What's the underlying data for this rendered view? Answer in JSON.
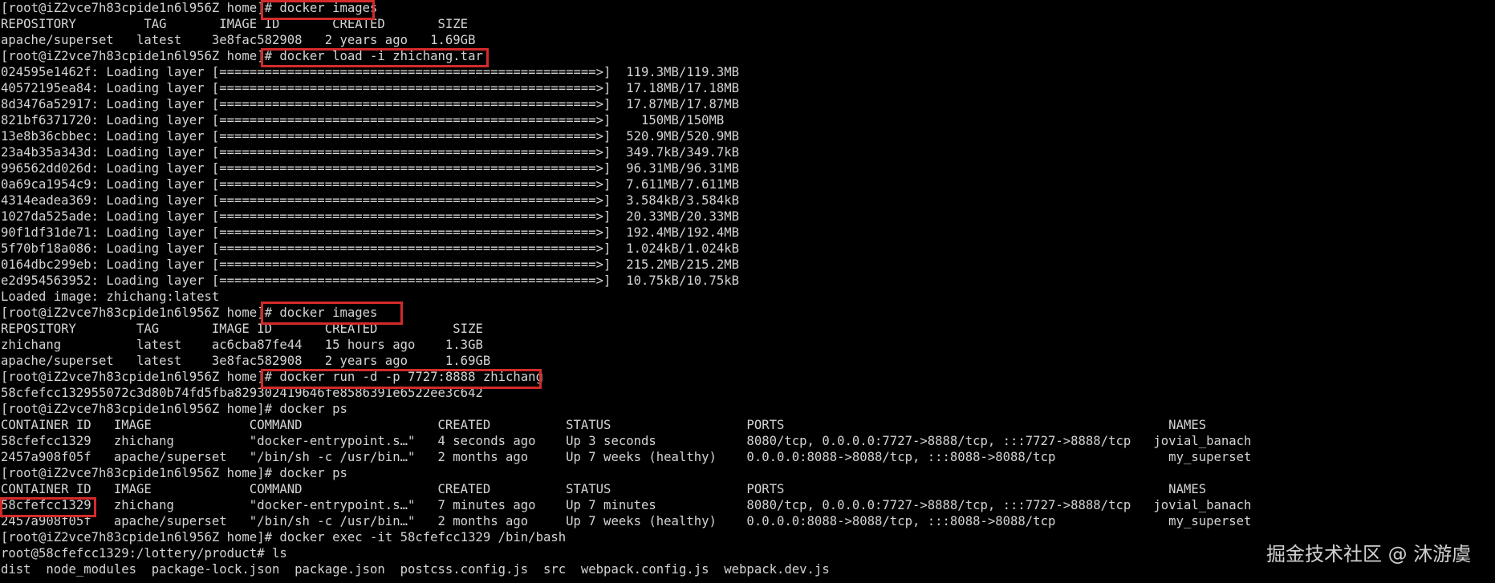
{
  "terminal": {
    "lines": [
      "[root@iZ2vce7h83cpide1n6l956Z home]# docker images",
      "REPOSITORY         TAG       IMAGE ID       CREATED       SIZE",
      "apache/superset   latest    3e8fac582908   2 years ago   1.69GB",
      "[root@iZ2vce7h83cpide1n6l956Z home]# docker load -i zhichang.tar",
      "024595e1462f: Loading layer [==================================================>]  119.3MB/119.3MB",
      "40572195ea84: Loading layer [==================================================>]  17.18MB/17.18MB",
      "8d3476a52917: Loading layer [==================================================>]  17.87MB/17.87MB",
      "821bf6371720: Loading layer [==================================================>]    150MB/150MB",
      "13e8b36cbbec: Loading layer [==================================================>]  520.9MB/520.9MB",
      "23a4b35a343d: Loading layer [==================================================>]  349.7kB/349.7kB",
      "996562dd026d: Loading layer [==================================================>]  96.31MB/96.31MB",
      "0a69ca1954c9: Loading layer [==================================================>]  7.611MB/7.611MB",
      "4314eadea369: Loading layer [==================================================>]  3.584kB/3.584kB",
      "1027da525ade: Loading layer [==================================================>]  20.33MB/20.33MB",
      "90f1df31de71: Loading layer [==================================================>]  192.4MB/192.4MB",
      "5f70bf18a086: Loading layer [==================================================>]  1.024kB/1.024kB",
      "0164dbc299eb: Loading layer [==================================================>]  215.2MB/215.2MB",
      "e2d954563952: Loading layer [==================================================>]  10.75kB/10.75kB",
      "Loaded image: zhichang:latest",
      "[root@iZ2vce7h83cpide1n6l956Z home]# docker images",
      "REPOSITORY        TAG       IMAGE ID       CREATED          SIZE",
      "zhichang          latest    ac6cba87fe44   15 hours ago    1.3GB",
      "apache/superset   latest    3e8fac582908   2 years ago     1.69GB",
      "[root@iZ2vce7h83cpide1n6l956Z home]# docker run -d -p 7727:8888 zhichang",
      "58cfefcc132955072c3d80b74fd5fba829302419646fe8586391e6522ee3c642",
      "[root@iZ2vce7h83cpide1n6l956Z home]# docker ps",
      "CONTAINER ID   IMAGE             COMMAND                  CREATED          STATUS                  PORTS                                                   NAMES",
      "58cfefcc1329   zhichang          \"docker-entrypoint.s…\"   4 seconds ago    Up 3 seconds            8080/tcp, 0.0.0.0:7727->8888/tcp, :::7727->8888/tcp   jovial_banach",
      "2457a908f05f   apache/superset   \"/bin/sh -c /usr/bin…\"   2 months ago     Up 7 weeks (healthy)    0.0.0.0:8088->8088/tcp, :::8088->8088/tcp               my_superset",
      "[root@iZ2vce7h83cpide1n6l956Z home]# docker ps",
      "CONTAINER ID   IMAGE             COMMAND                  CREATED          STATUS                  PORTS                                                   NAMES",
      "58cfefcc1329   zhichang          \"docker-entrypoint.s…\"   7 minutes ago    Up 7 minutes            8080/tcp, 0.0.0.0:7727->8888/tcp, :::7727->8888/tcp   jovial_banach",
      "2457a908f05f   apache/superset   \"/bin/sh -c /usr/bin…\"   2 months ago     Up 7 weeks (healthy)    0.0.0.0:8088->8088/tcp, :::8088->8088/tcp               my_superset",
      "[root@iZ2vce7h83cpide1n6l956Z home]# docker exec -it 58cfefcc1329 /bin/bash",
      "root@58cfefcc1329:/lottery/product# ls",
      "dist  node_modules  package-lock.json  package.json  postcss.config.js  src  webpack.config.js  webpack.dev.js"
    ],
    "watermark": "掘金技术社区 @ 沐游虞",
    "colors": {
      "background": "#000000",
      "text": "#d4d4d4",
      "highlight_box": "#d42a2a"
    }
  }
}
